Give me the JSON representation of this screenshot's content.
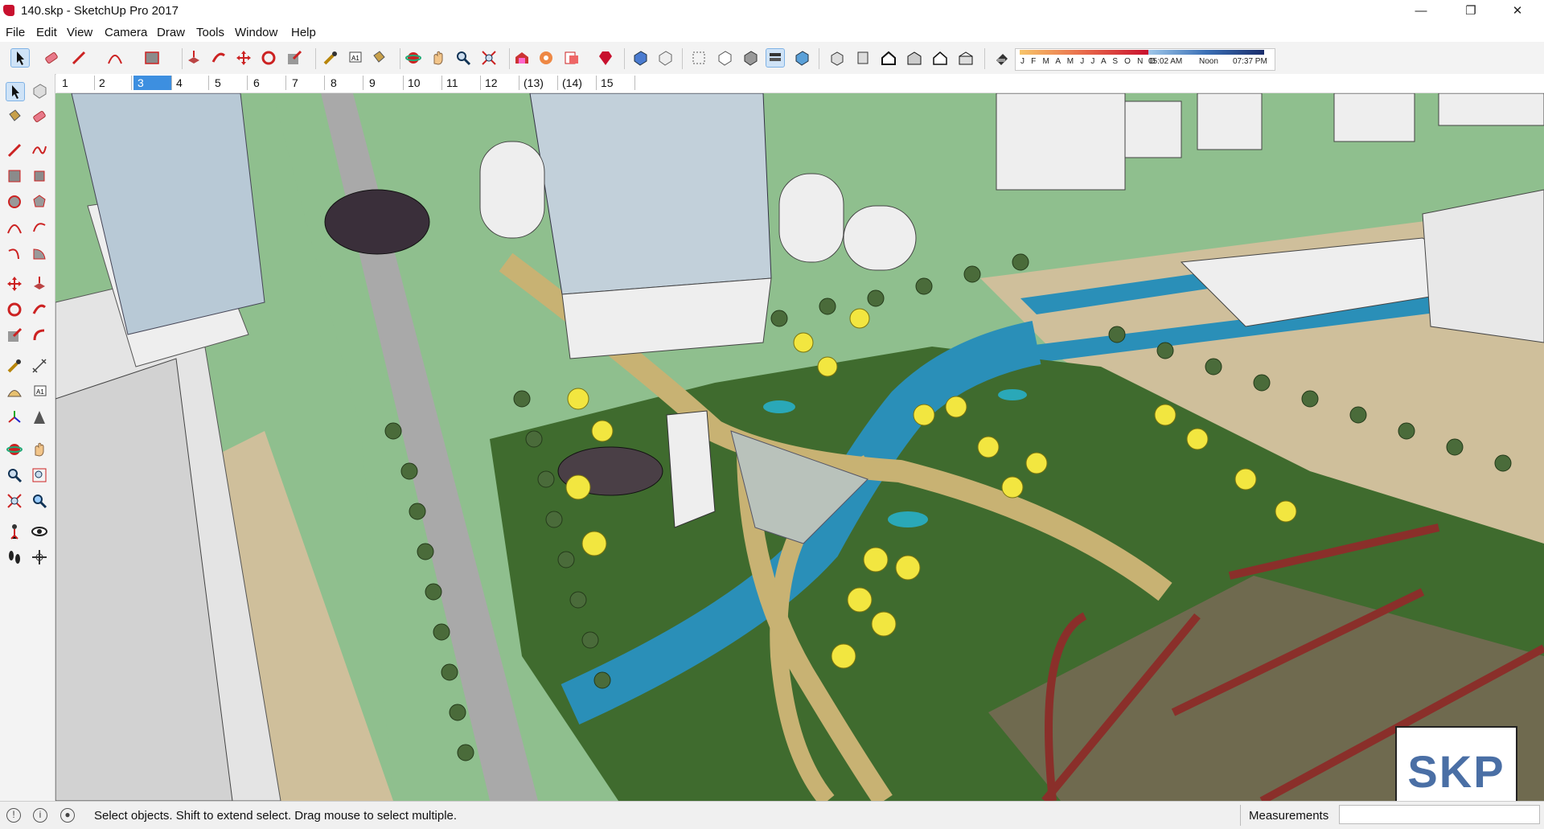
{
  "window": {
    "title": "140.skp - SketchUp Pro 2017",
    "controls": [
      "minimize-icon",
      "restore-icon",
      "close-icon"
    ],
    "control_glyphs": [
      "—",
      "❐",
      "✕"
    ]
  },
  "menubar": {
    "items": [
      "File",
      "Edit",
      "View",
      "Camera",
      "Draw",
      "Tools",
      "Window",
      "Help"
    ]
  },
  "toolbar": {
    "buttons": [
      "select-icon",
      "eraser-icon",
      "line-icon",
      "arc-icon",
      "rectangle-icon",
      "push-pull-icon",
      "follow-me-icon",
      "move-icon",
      "rotate-icon",
      "scale-icon",
      "tape-measure-icon",
      "text-icon",
      "paint-bucket-icon",
      "orbit-icon",
      "pan-icon",
      "zoom-icon",
      "zoom-extents-icon",
      "warehouse-icon",
      "extension-warehouse-icon",
      "layout-icon",
      "ruby-icon",
      "section-plane-icon",
      "section-display-icon",
      "xray-icon",
      "back-edges-icon",
      "wireframe-icon",
      "hidden-line-icon",
      "shaded-icon",
      "shaded-textures-icon",
      "monochrome-icon",
      "iso-view-icon",
      "top-view-icon",
      "front-view-icon",
      "right-view-icon",
      "back-view-icon",
      "left-view-icon",
      "shadows-toggle-icon"
    ],
    "shadow_months": "J F M A M J J A S O N D",
    "shadow_time_start": "05:02 AM",
    "shadow_time_mid": "Noon",
    "shadow_time_end": "07:37 PM",
    "colors": {
      "months_gradient": [
        "#f7c46a",
        "#e86a4a",
        "#c8102e"
      ],
      "time_gradient": [
        "#9ec7ea",
        "#3a6fb5",
        "#1a2d6b"
      ]
    }
  },
  "scenes": {
    "tabs": [
      "1",
      "2",
      "3",
      "4",
      "5",
      "6",
      "7",
      "8",
      "9",
      "10",
      "11",
      "12",
      "(13)",
      "(14)",
      "15"
    ],
    "active_index": 2
  },
  "left_tools": [
    "select-icon",
    "component-icon",
    "paint-bucket-icon",
    "eraser-icon",
    "line-icon",
    "freehand-icon",
    "rectangle-icon",
    "rotated-rectangle-icon",
    "circle-icon",
    "polygon-icon",
    "arc-icon",
    "two-point-arc-icon",
    "three-point-arc-icon",
    "pie-icon",
    "move-icon",
    "push-pull-icon",
    "rotate-icon",
    "follow-me-icon",
    "scale-icon",
    "offset-icon",
    "tape-measure-icon",
    "dimension-icon",
    "protractor-icon",
    "text-icon",
    "axes-icon",
    "3d-text-icon",
    "orbit-icon",
    "pan-icon",
    "zoom-icon",
    "zoom-window-icon",
    "zoom-extents-icon",
    "previous-view-icon",
    "position-camera-icon",
    "look-around-icon",
    "walk-icon",
    "section-plane-icon"
  ],
  "viewport": {
    "description_icon": "3d-model-viewport",
    "colors": {
      "grass": "#3f6b2e",
      "light_grass": "#8fbf8e",
      "water": "#2a8fb8",
      "path": "#c8b273",
      "road": "#a9a9a9",
      "brick": "#8a2f2a",
      "building": "#eeeeee",
      "tree": "#4a6b3a",
      "palm": "#f2e640"
    }
  },
  "status": {
    "message": "Select objects. Shift to extend select. Drag mouse to select multiple.",
    "measurements_label": "Measurements",
    "measurements_value": ""
  },
  "watermark": {
    "text": "SKP"
  }
}
